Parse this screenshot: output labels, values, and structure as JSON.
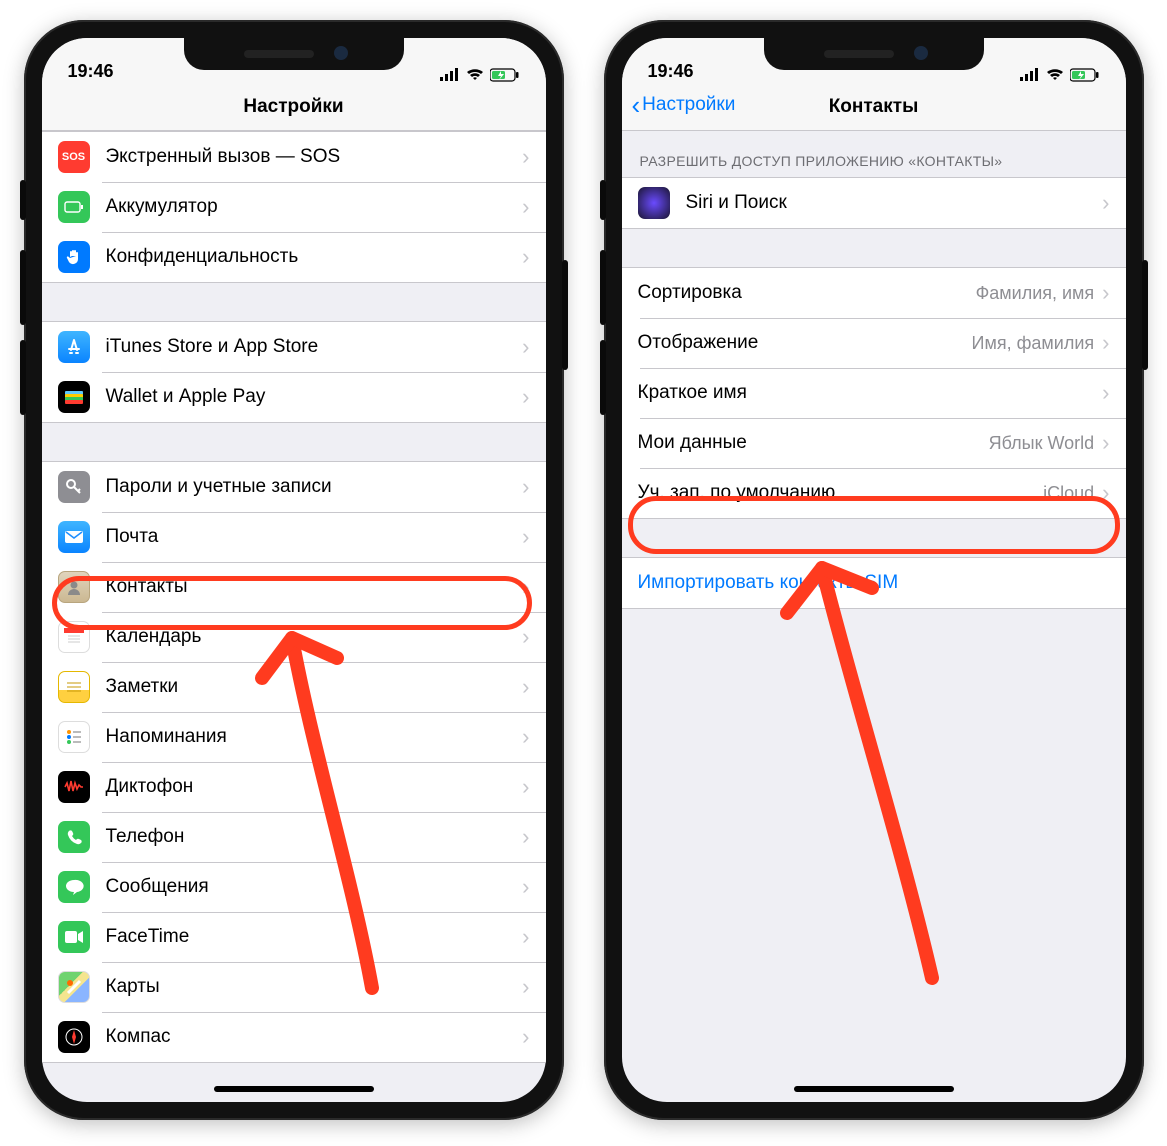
{
  "status": {
    "time": "19:46"
  },
  "left": {
    "nav_title": "Настройки",
    "groups": [
      {
        "items": [
          {
            "icon": "sos",
            "label": "Экстренный вызов — SOS"
          },
          {
            "icon": "battery",
            "label": "Аккумулятор"
          },
          {
            "icon": "privacy",
            "label": "Конфиденциальность"
          }
        ]
      },
      {
        "items": [
          {
            "icon": "appstore",
            "label": "iTunes Store и App Store"
          },
          {
            "icon": "wallet",
            "label": "Wallet и Apple Pay"
          }
        ]
      },
      {
        "items": [
          {
            "icon": "passwords",
            "label": "Пароли и учетные записи"
          },
          {
            "icon": "mail",
            "label": "Почта"
          },
          {
            "icon": "contacts",
            "label": "Контакты"
          },
          {
            "icon": "calendar",
            "label": "Календарь"
          },
          {
            "icon": "notes",
            "label": "Заметки"
          },
          {
            "icon": "reminders",
            "label": "Напоминания"
          },
          {
            "icon": "voicememos",
            "label": "Диктофон"
          },
          {
            "icon": "phone",
            "label": "Телефон"
          },
          {
            "icon": "messages",
            "label": "Сообщения"
          },
          {
            "icon": "facetime",
            "label": "FaceTime"
          },
          {
            "icon": "maps",
            "label": "Карты"
          },
          {
            "icon": "compass",
            "label": "Компас"
          }
        ]
      }
    ]
  },
  "right": {
    "nav_back": "Настройки",
    "nav_title": "Контакты",
    "section_header": "РАЗРЕШИТЬ ДОСТУП ПРИЛОЖЕНИЮ «КОНТАКТЫ»",
    "siri_label": "Siri и Поиск",
    "rows": [
      {
        "label": "Сортировка",
        "value": "Фамилия, имя"
      },
      {
        "label": "Отображение",
        "value": "Имя, фамилия"
      },
      {
        "label": "Краткое имя",
        "value": ""
      },
      {
        "label": "Мои данные",
        "value": "Яблык World"
      },
      {
        "label": "Уч. зап. по умолчанию",
        "value": "iCloud"
      }
    ],
    "import_sim": "Импортировать контакты SIM"
  },
  "icon_colors": {
    "sos": "#ff3b30",
    "battery": "#34c759",
    "privacy": "#007aff",
    "appstore": "#1f8fff",
    "wallet": "#000",
    "passwords": "#8e8e93",
    "mail": "#1f8fff",
    "contacts": "#d9c6a5",
    "calendar": "#ffffff",
    "notes": "#ffd040",
    "reminders": "#ffffff",
    "voicememos": "#000",
    "phone": "#34c759",
    "messages": "#34c759",
    "facetime": "#34c759",
    "maps": "#ffffff",
    "compass": "#000",
    "siri": "#1a1530"
  }
}
